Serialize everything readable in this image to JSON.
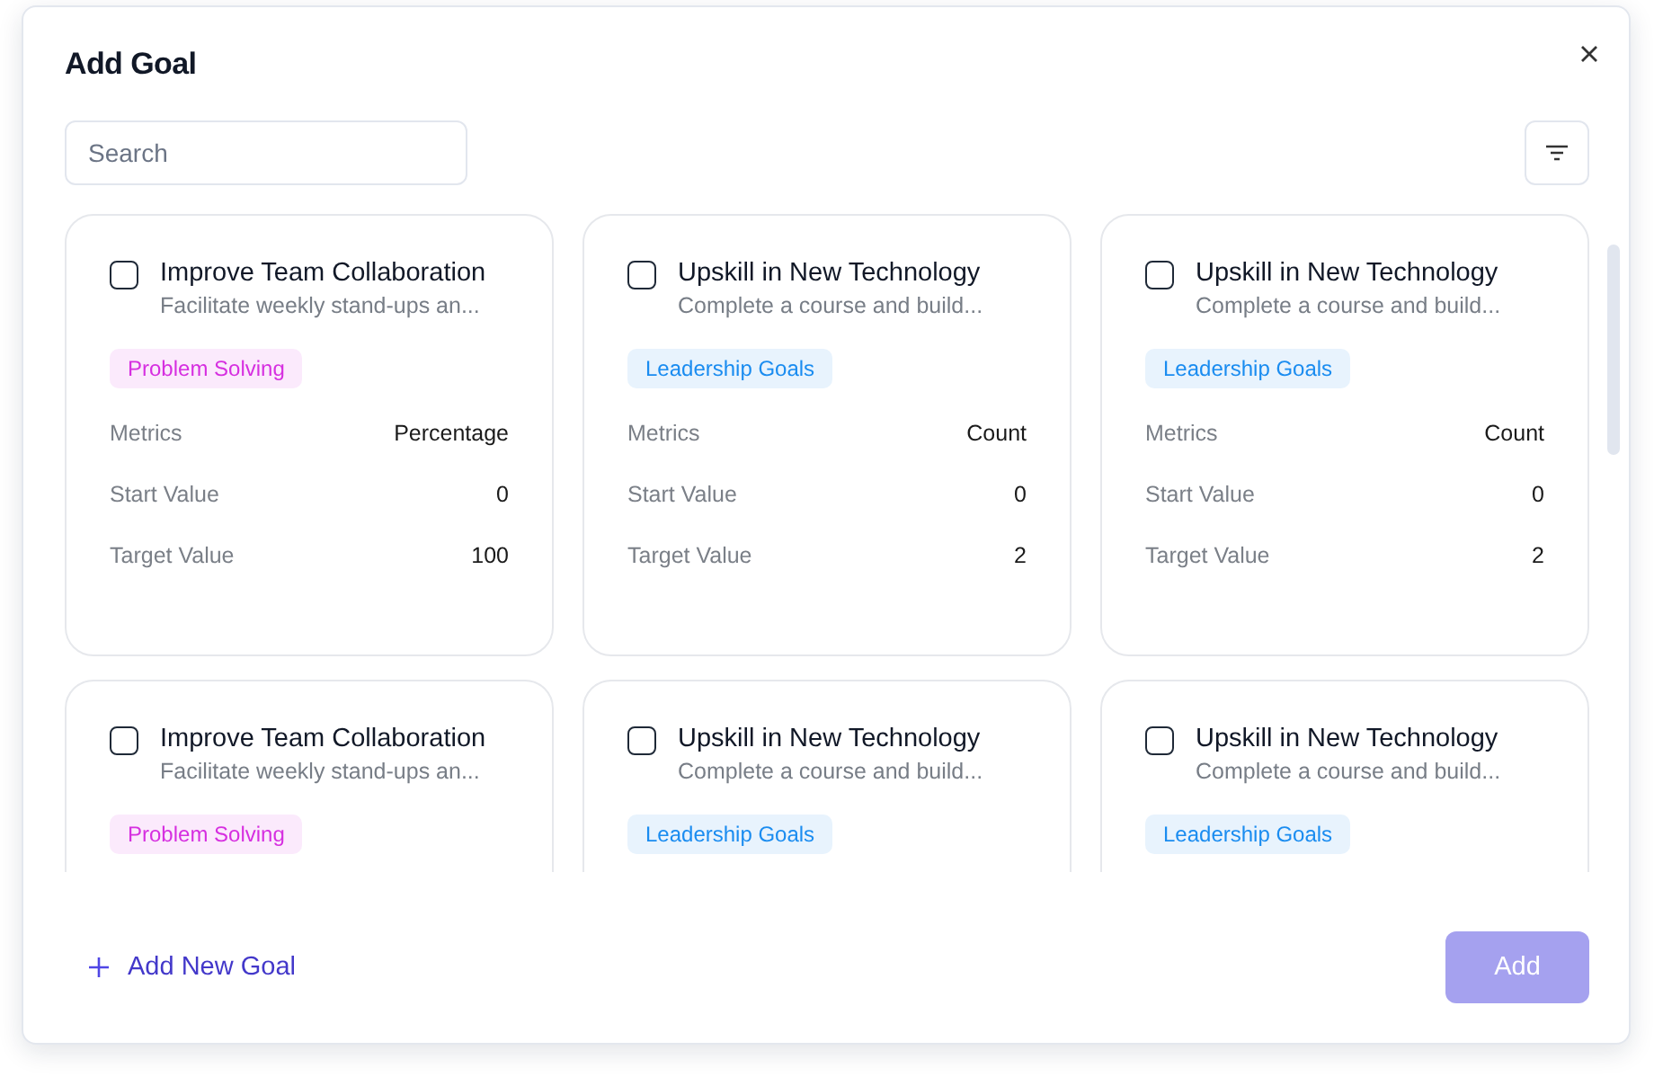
{
  "dialog": {
    "title": "Add Goal"
  },
  "search": {
    "placeholder": "Search"
  },
  "goals": [
    {
      "title": "Improve Team Collaboration",
      "description": "Facilitate weekly stand-ups an...",
      "checked": false,
      "tag": {
        "label": "Problem Solving",
        "color": "#d62fe0"
      },
      "metrics": [
        {
          "label": "Metrics",
          "value": "Percentage"
        },
        {
          "label": "Start Value",
          "value": "0"
        },
        {
          "label": "Target Value",
          "value": "100"
        }
      ]
    },
    {
      "title": "Upskill in New Technology",
      "description": "Complete a course and build...",
      "checked": false,
      "tag": {
        "label": "Leadership Goals",
        "color": "#1a8cf0"
      },
      "metrics": [
        {
          "label": "Metrics",
          "value": "Count"
        },
        {
          "label": "Start Value",
          "value": "0"
        },
        {
          "label": "Target Value",
          "value": "2"
        }
      ]
    },
    {
      "title": "Upskill in New Technology",
      "description": "Complete a course and build...",
      "checked": false,
      "tag": {
        "label": "Leadership Goals",
        "color": "#1a8cf0"
      },
      "metrics": [
        {
          "label": "Metrics",
          "value": "Count"
        },
        {
          "label": "Start Value",
          "value": "0"
        },
        {
          "label": "Target Value",
          "value": "2"
        }
      ]
    },
    {
      "title": "Improve Team Collaboration",
      "description": "Facilitate weekly stand-ups an...",
      "checked": false,
      "tag": {
        "label": "Problem Solving",
        "color": "#d62fe0"
      }
    },
    {
      "title": "Upskill in New Technology",
      "description": "Complete a course and build...",
      "checked": false,
      "tag": {
        "label": "Leadership Goals",
        "color": "#1a8cf0"
      }
    },
    {
      "title": "Upskill in New Technology",
      "description": "Complete a course and build...",
      "checked": false,
      "tag": {
        "label": "Leadership Goals",
        "color": "#1a8cf0"
      }
    }
  ],
  "footer": {
    "add_new_label": "Add New Goal",
    "submit": {
      "label": "Add",
      "disabled": true
    }
  }
}
